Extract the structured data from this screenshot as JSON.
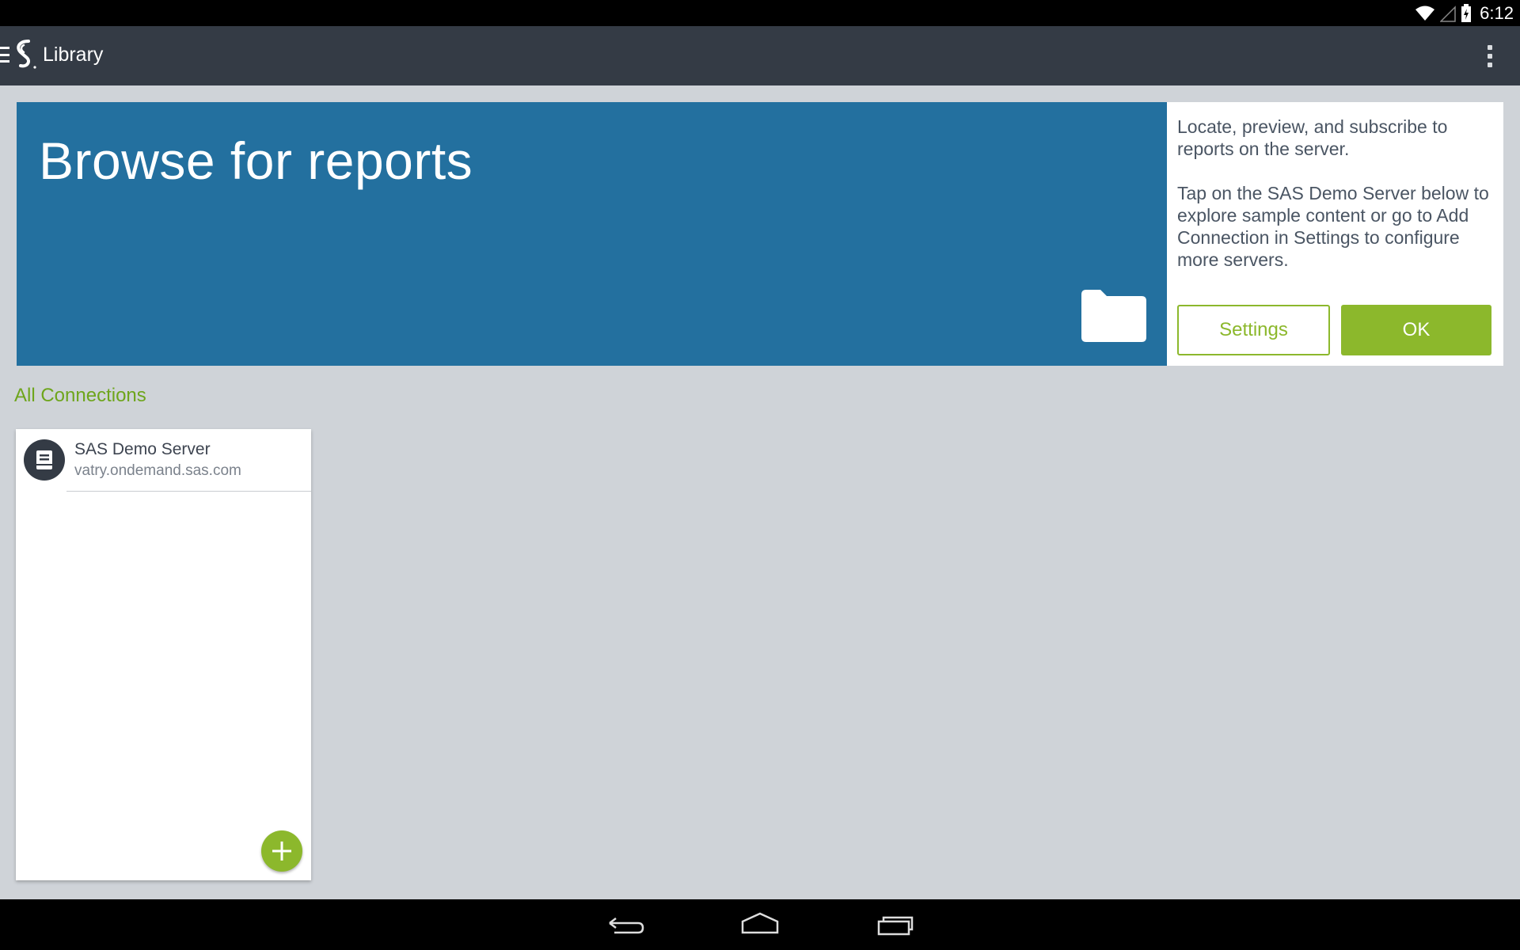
{
  "status_bar": {
    "time": "6:12",
    "icons": [
      "wifi-icon",
      "signal-icon",
      "battery-icon"
    ]
  },
  "app_bar": {
    "title": "Library",
    "icons": [
      "menu-icon",
      "sas-logo-icon",
      "overflow-menu-icon"
    ]
  },
  "hero": {
    "title": "Browse for reports",
    "icon": "folder-icon",
    "background": "#23709f"
  },
  "info_panel": {
    "paragraph1": "Locate, preview, and subscribe to reports on the server.",
    "paragraph2": "Tap on the SAS Demo Server below to explore sample content or go to Add Connection in Settings to configure more servers.",
    "settings_label": "Settings",
    "ok_label": "OK"
  },
  "connections": {
    "section_title": "All Connections",
    "items": [
      {
        "name": "SAS Demo Server",
        "host": "vatry.ondemand.sas.com",
        "icon": "server-icon"
      }
    ],
    "add_icon": "add-icon"
  },
  "nav_bar": {
    "icons": [
      "back-icon",
      "home-icon",
      "recents-icon"
    ]
  },
  "colors": {
    "accent": "#8cb82c",
    "app_bar": "#343b45",
    "background": "#cfd3d8"
  }
}
